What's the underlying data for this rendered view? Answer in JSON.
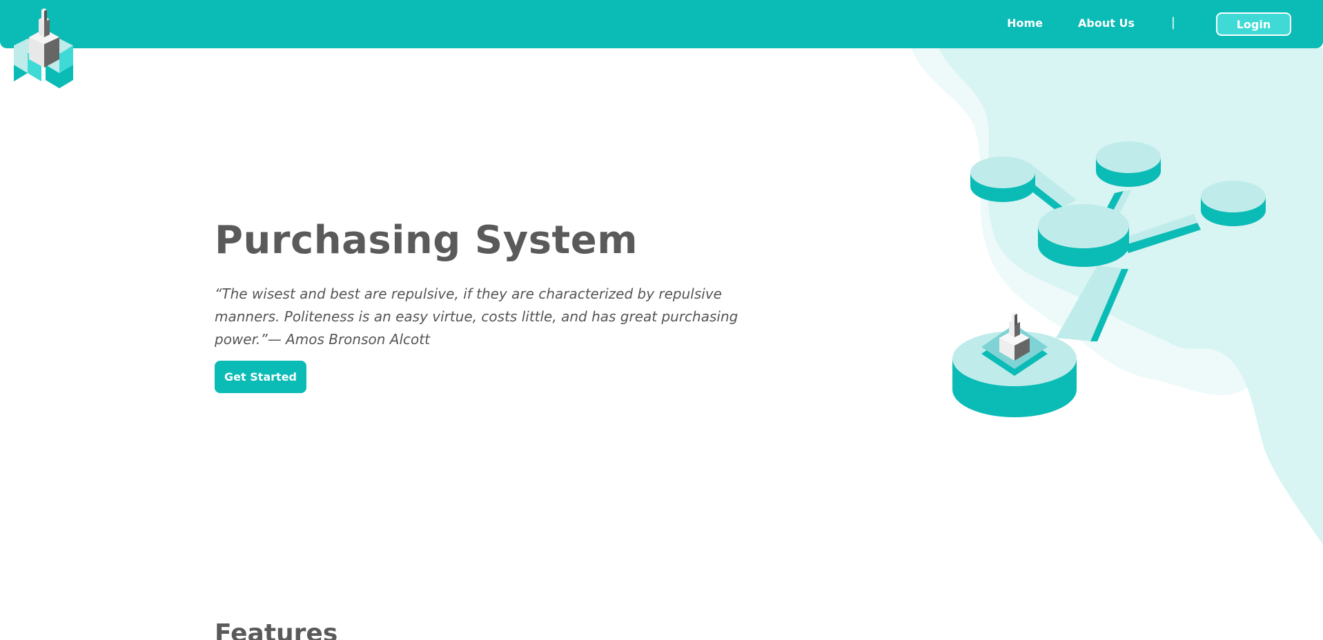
{
  "nav": {
    "home": "Home",
    "about": "About Us",
    "separator": "|",
    "login": "Login"
  },
  "hero": {
    "title": "Purchasing System",
    "quote": "“The wisest and best are repulsive, if they are characterized by repulsive manners. Politeness is an easy virtue, costs little, and has great purchasing power.”— Amos Bronson Alcott",
    "cta": "Get Started"
  },
  "features": {
    "heading": "Features"
  },
  "colors": {
    "brand": "#0bbbb6",
    "brand_light": "#bfecea",
    "text": "#5a5a5a"
  },
  "icons": {
    "logo": "isometric-tower-logo",
    "illustration": "isometric-network-illustration"
  }
}
